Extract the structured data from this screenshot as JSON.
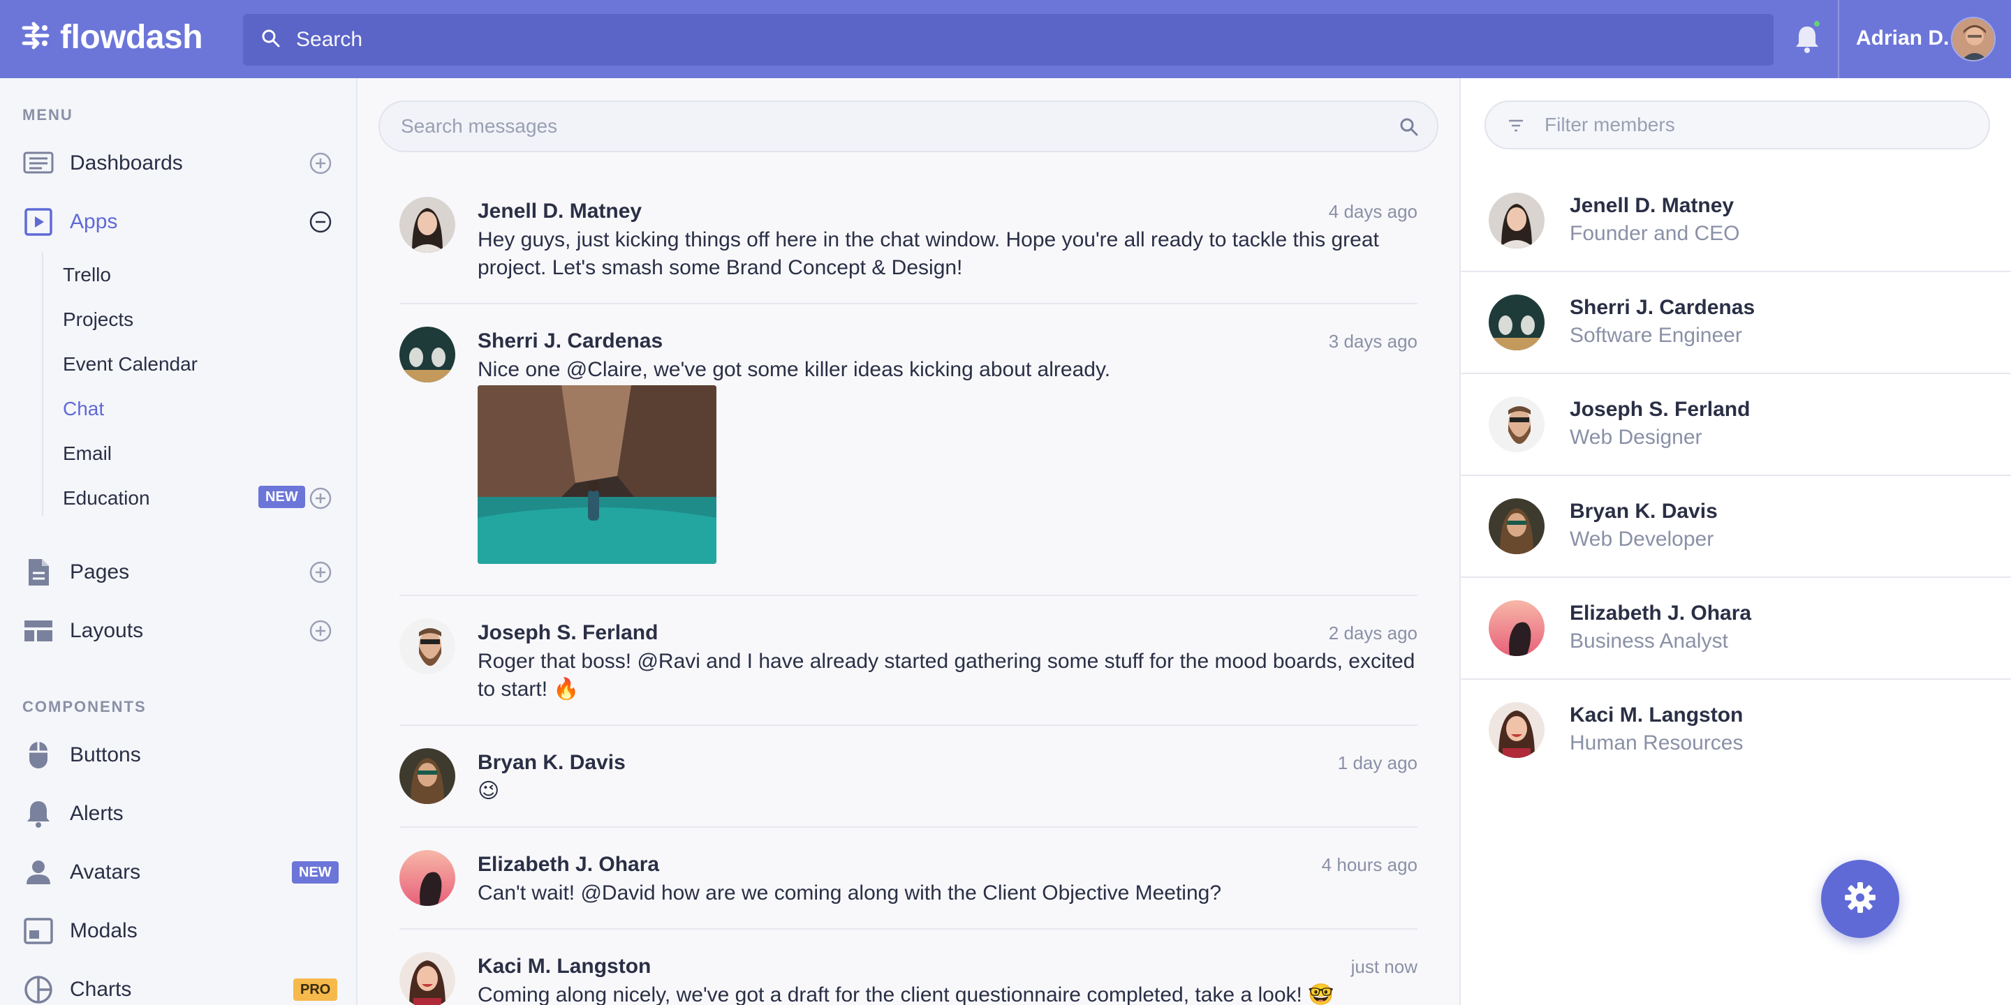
{
  "brand": {
    "name": "flowdash",
    "icon": "flow-logo-icon"
  },
  "topbar": {
    "search_placeholder": "Search",
    "user_name": "Adrian D.",
    "notification_icon": "bell-icon",
    "notification_status_color": "#66d177"
  },
  "colors": {
    "accent": "#5f6ad6",
    "topbar": "#6c76d8",
    "new_badge": "#6c76d8",
    "pro_badge": "#f6b94c"
  },
  "sidebar": {
    "menu_label": "MENU",
    "components_label": "COMPONENTS",
    "menu": [
      {
        "label": "Dashboards",
        "icon": "dashboard-icon",
        "action": "add-icon"
      },
      {
        "label": "Apps",
        "icon": "play-icon",
        "action": "minus-icon",
        "active": true
      },
      {
        "label": "Pages",
        "icon": "document-icon",
        "action": "add-icon"
      },
      {
        "label": "Layouts",
        "icon": "layout-icon",
        "action": "add-icon"
      }
    ],
    "apps_sub": [
      {
        "label": "Trello"
      },
      {
        "label": "Projects"
      },
      {
        "label": "Event Calendar"
      },
      {
        "label": "Chat",
        "active": true
      },
      {
        "label": "Email"
      },
      {
        "label": "Education",
        "badge": "NEW"
      }
    ],
    "components": [
      {
        "label": "Buttons",
        "icon": "mouse-icon"
      },
      {
        "label": "Alerts",
        "icon": "bell-icon"
      },
      {
        "label": "Avatars",
        "icon": "person-icon",
        "badge": "NEW"
      },
      {
        "label": "Modals",
        "icon": "modal-icon"
      },
      {
        "label": "Charts",
        "icon": "pie-chart-icon",
        "badge": "PRO"
      }
    ]
  },
  "chat": {
    "search_placeholder": "Search messages",
    "messages": [
      {
        "author": "Jenell D. Matney",
        "time": "4 days ago",
        "text": "Hey guys, just kicking things off here in the chat window. Hope you're all ready to tackle this great project. Let's smash some Brand Concept & Design!"
      },
      {
        "author": "Sherri J. Cardenas",
        "time": "3 days ago",
        "text": "Nice one @Claire, we've got some killer ideas kicking about already.",
        "image": "canyon-river-photo"
      },
      {
        "author": "Joseph S. Ferland",
        "time": "2 days ago",
        "text": "Roger that boss! @Ravi and I have already started gathering some stuff for the mood boards, excited to start! 🔥"
      },
      {
        "author": "Bryan K. Davis",
        "time": "1 day ago",
        "text": "😉"
      },
      {
        "author": "Elizabeth J. Ohara",
        "time": "4 hours ago",
        "text": "Can't wait! @David how are we coming along with the Client Objective Meeting?"
      },
      {
        "author": "Kaci M. Langston",
        "time": "just now",
        "text": "Coming along nicely, we've got a draft for the client questionnaire completed, take a look! 🤓"
      }
    ]
  },
  "members": {
    "filter_placeholder": "Filter members",
    "list": [
      {
        "name": "Jenell D. Matney",
        "role": "Founder and CEO"
      },
      {
        "name": "Sherri J. Cardenas",
        "role": "Software Engineer"
      },
      {
        "name": "Joseph S. Ferland",
        "role": "Web Designer"
      },
      {
        "name": "Bryan K. Davis",
        "role": "Web Developer"
      },
      {
        "name": "Elizabeth J. Ohara",
        "role": "Business Analyst"
      },
      {
        "name": "Kaci M. Langston",
        "role": "Human Resources"
      }
    ]
  },
  "fab_icon": "gear-icon"
}
